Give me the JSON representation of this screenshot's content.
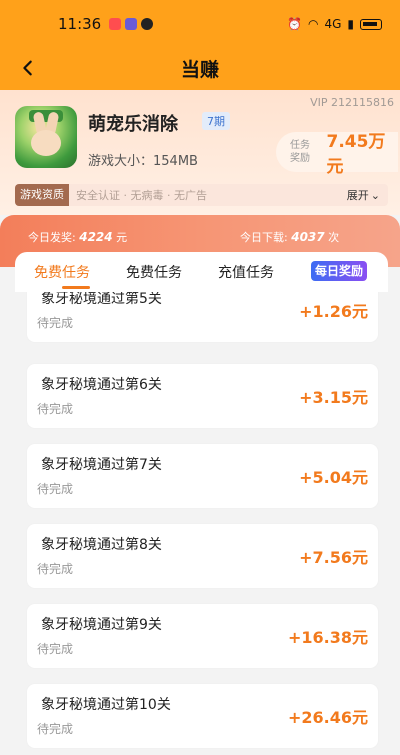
{
  "status_bar": {
    "time": "11:36",
    "network": "4G"
  },
  "header": {
    "title": "当赚"
  },
  "app": {
    "vip_id": "VIP 212115816",
    "name": "萌宠乐消除",
    "period": "7期",
    "size_label": "游戏大小：154MB",
    "reward_label": "任务奖励",
    "reward_amount": "7.45万元"
  },
  "qualification": {
    "tag": "游戏资质",
    "text": "安全认证 · 无病毒 · 无广告",
    "expand_label": "展开"
  },
  "stats": {
    "today_reward_label": "今日发奖:",
    "today_reward_value": "4224",
    "today_reward_unit": "元",
    "today_download_label": "今日下载:",
    "today_download_value": "4037",
    "today_download_unit": "次"
  },
  "tabs": [
    {
      "label": "免费任务",
      "active": true
    },
    {
      "label": "免费任务",
      "active": false
    },
    {
      "label": "充值任务",
      "active": false
    }
  ],
  "daily_badge": "每日奖励",
  "tasks": [
    {
      "title": "象牙秘境通过第5关",
      "status": "待完成",
      "reward": "+1.26元"
    },
    {
      "title": "象牙秘境通过第6关",
      "status": "待完成",
      "reward": "+3.15元"
    },
    {
      "title": "象牙秘境通过第7关",
      "status": "待完成",
      "reward": "+5.04元"
    },
    {
      "title": "象牙秘境通过第8关",
      "status": "待完成",
      "reward": "+7.56元"
    },
    {
      "title": "象牙秘境通过第9关",
      "status": "待完成",
      "reward": "+16.38元"
    },
    {
      "title": "象牙秘境通过第10关",
      "status": "待完成",
      "reward": "+26.46元"
    }
  ],
  "colors": {
    "accent": "#f27a1d",
    "header_bg": "#ffa11a"
  }
}
